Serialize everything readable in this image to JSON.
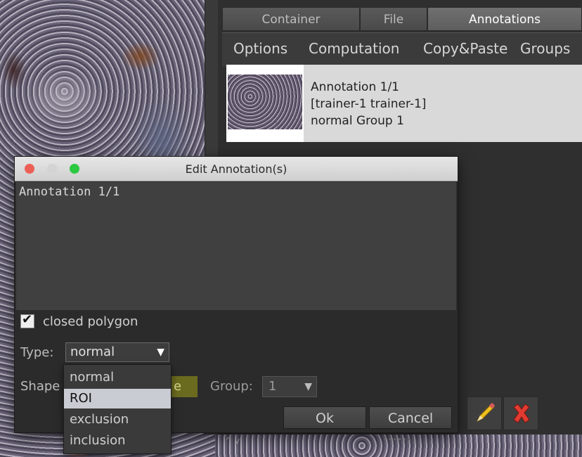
{
  "tabs": [
    "Container",
    "File",
    "Annotations"
  ],
  "active_tab": "Annotations",
  "subtabs": [
    "Options",
    "Computation",
    "Copy&Paste",
    "Groups"
  ],
  "annotation_item": {
    "line1": "Annotation 1/1",
    "line2": "[trainer-1 trainer-1]",
    "line3": "normal Group 1"
  },
  "dialog": {
    "title": "Edit Annotation(s)",
    "text": "Annotation 1/1",
    "closed_polygon_label": "closed polygon",
    "closed_polygon_checked": true,
    "type_label": "Type:",
    "type_value": "normal",
    "shape_label": "Shape",
    "shape_value": "e",
    "group_label": "Group:",
    "group_value": "1",
    "ok_label": "Ok",
    "cancel_label": "Cancel"
  },
  "type_options": [
    "normal",
    "ROI",
    "exclusion",
    "inclusion"
  ],
  "type_highlighted": "ROI",
  "status": {
    "arrows": "^ v",
    "grip": "••••••"
  },
  "colors": {
    "close": "#ec5f57",
    "minimize": "#d3d3d3",
    "zoom": "#2cc840",
    "delete": "#e23b30",
    "pencil": "#f0c020"
  }
}
